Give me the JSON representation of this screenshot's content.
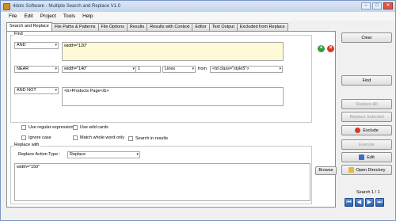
{
  "window": {
    "title": "4dots Software - Multiple Search and Replace V1.0",
    "min": "–",
    "max": "□",
    "close": "✕"
  },
  "menu": [
    "File",
    "Edit",
    "Project",
    "Tools",
    "Help"
  ],
  "tabs": [
    "Search and Replace",
    "File Paths & Patterns",
    "File Options",
    "Results",
    "Results with Context",
    "Editor",
    "Text Output",
    "Excluded from Replace"
  ],
  "find": {
    "label": "Find",
    "row1": {
      "op": "AND",
      "text": "width=\"120\""
    },
    "row2": {
      "op": "NEAR",
      "text": "width=\"140\"",
      "count": "1",
      "unit": "Lines",
      "from_label": "from",
      "from_value": "<td class=\"style5\">"
    },
    "row3": {
      "op": "AND NOT",
      "text": "<b>Products Page</b>"
    }
  },
  "options": {
    "regex": "Use regular expression",
    "wildcards": "Use wild cards",
    "ignore_case": "Ignore case",
    "whole_word": "Match whole word only",
    "search_results": "Search in results"
  },
  "replace": {
    "label": "Replace with",
    "action_label": "Replace Action Type :",
    "action_value": "Replace",
    "text": "width=\"150\"",
    "browse": "Browse"
  },
  "right_buttons": {
    "clear": "Clear",
    "find": "Find",
    "replace_all": "Replace All",
    "replace_selected": "Replace Selected",
    "exclude": "Exclude",
    "execute": "Execute",
    "edit": "Edit",
    "open_directory": "Open Directory"
  },
  "search_counter": "Search 1 / 1",
  "nav": {
    "first": "⏮",
    "prev": "◀",
    "next": "▶",
    "last": "⏭"
  },
  "icons": {
    "add": "+",
    "remove": "×"
  }
}
